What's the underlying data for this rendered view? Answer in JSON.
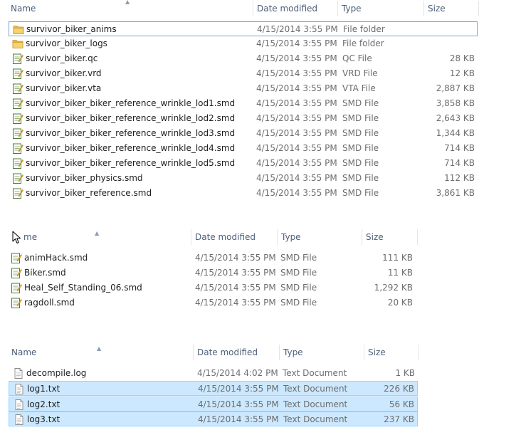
{
  "columns": {
    "name": "Name",
    "date": "Date modified",
    "type": "Type",
    "size": "Size"
  },
  "pane1": {
    "sort_icon": "sort-ascending-icon",
    "rows": [
      {
        "name": "survivor_biker_anims",
        "date": "4/15/2014 3:55 PM",
        "type": "File folder",
        "size": "",
        "icon": "folder-icon",
        "state": "focused"
      },
      {
        "name": "survivor_biker_logs",
        "date": "4/15/2014 3:55 PM",
        "type": "File folder",
        "size": "",
        "icon": "folder-icon",
        "state": ""
      },
      {
        "name": "survivor_biker.qc",
        "date": "4/15/2014 3:55 PM",
        "type": "QC File",
        "size": "28 KB",
        "icon": "text-file-icon",
        "state": ""
      },
      {
        "name": "survivor_biker.vrd",
        "date": "4/15/2014 3:55 PM",
        "type": "VRD File",
        "size": "12 KB",
        "icon": "text-file-icon",
        "state": ""
      },
      {
        "name": "survivor_biker.vta",
        "date": "4/15/2014 3:55 PM",
        "type": "VTA File",
        "size": "2,887 KB",
        "icon": "text-file-icon",
        "state": ""
      },
      {
        "name": "survivor_biker_biker_reference_wrinkle_lod1.smd",
        "date": "4/15/2014 3:55 PM",
        "type": "SMD File",
        "size": "3,858 KB",
        "icon": "text-file-icon",
        "state": ""
      },
      {
        "name": "survivor_biker_biker_reference_wrinkle_lod2.smd",
        "date": "4/15/2014 3:55 PM",
        "type": "SMD File",
        "size": "2,643 KB",
        "icon": "text-file-icon",
        "state": ""
      },
      {
        "name": "survivor_biker_biker_reference_wrinkle_lod3.smd",
        "date": "4/15/2014 3:55 PM",
        "type": "SMD File",
        "size": "1,344 KB",
        "icon": "text-file-icon",
        "state": ""
      },
      {
        "name": "survivor_biker_biker_reference_wrinkle_lod4.smd",
        "date": "4/15/2014 3:55 PM",
        "type": "SMD File",
        "size": "714 KB",
        "icon": "text-file-icon",
        "state": ""
      },
      {
        "name": "survivor_biker_biker_reference_wrinkle_lod5.smd",
        "date": "4/15/2014 3:55 PM",
        "type": "SMD File",
        "size": "714 KB",
        "icon": "text-file-icon",
        "state": ""
      },
      {
        "name": "survivor_biker_physics.smd",
        "date": "4/15/2014 3:55 PM",
        "type": "SMD File",
        "size": "112 KB",
        "icon": "text-file-icon",
        "state": ""
      },
      {
        "name": "survivor_biker_reference.smd",
        "date": "4/15/2014 3:55 PM",
        "type": "SMD File",
        "size": "3,861 KB",
        "icon": "text-file-icon",
        "state": ""
      }
    ]
  },
  "pane2": {
    "header_name": "me",
    "sort_icon": "sort-ascending-icon",
    "cursor_icon": "mouse-pointer-icon",
    "rows": [
      {
        "name": "animHack.smd",
        "date": "4/15/2014 3:55 PM",
        "type": "SMD File",
        "size": "111 KB",
        "icon": "text-file-icon",
        "state": ""
      },
      {
        "name": "Biker.smd",
        "date": "4/15/2014 3:55 PM",
        "type": "SMD File",
        "size": "11 KB",
        "icon": "text-file-icon",
        "state": ""
      },
      {
        "name": "Heal_Self_Standing_06.smd",
        "date": "4/15/2014 3:55 PM",
        "type": "SMD File",
        "size": "1,292 KB",
        "icon": "text-file-icon",
        "state": ""
      },
      {
        "name": "ragdoll.smd",
        "date": "4/15/2014 3:55 PM",
        "type": "SMD File",
        "size": "20 KB",
        "icon": "text-file-icon",
        "state": ""
      }
    ]
  },
  "pane3": {
    "sort_icon": "sort-ascending-icon",
    "rows": [
      {
        "name": "decompile.log",
        "date": "4/15/2014 4:02 PM",
        "type": "Text Document",
        "size": "1 KB",
        "icon": "plain-document-icon",
        "state": ""
      },
      {
        "name": "log1.txt",
        "date": "4/15/2014 3:55 PM",
        "type": "Text Document",
        "size": "226 KB",
        "icon": "plain-document-icon",
        "state": "selected"
      },
      {
        "name": "log2.txt",
        "date": "4/15/2014 3:55 PM",
        "type": "Text Document",
        "size": "56 KB",
        "icon": "plain-document-icon",
        "state": "selected"
      },
      {
        "name": "log3.txt",
        "date": "4/15/2014 3:55 PM",
        "type": "Text Document",
        "size": "237 KB",
        "icon": "plain-document-icon",
        "state": "selected"
      }
    ]
  },
  "colors": {
    "selection_fill": "#cce8ff",
    "selection_border": "#99d1ff",
    "focus_border": "#7da2ce",
    "header_text": "#4c607a",
    "meta_text": "#6d6d6d"
  }
}
